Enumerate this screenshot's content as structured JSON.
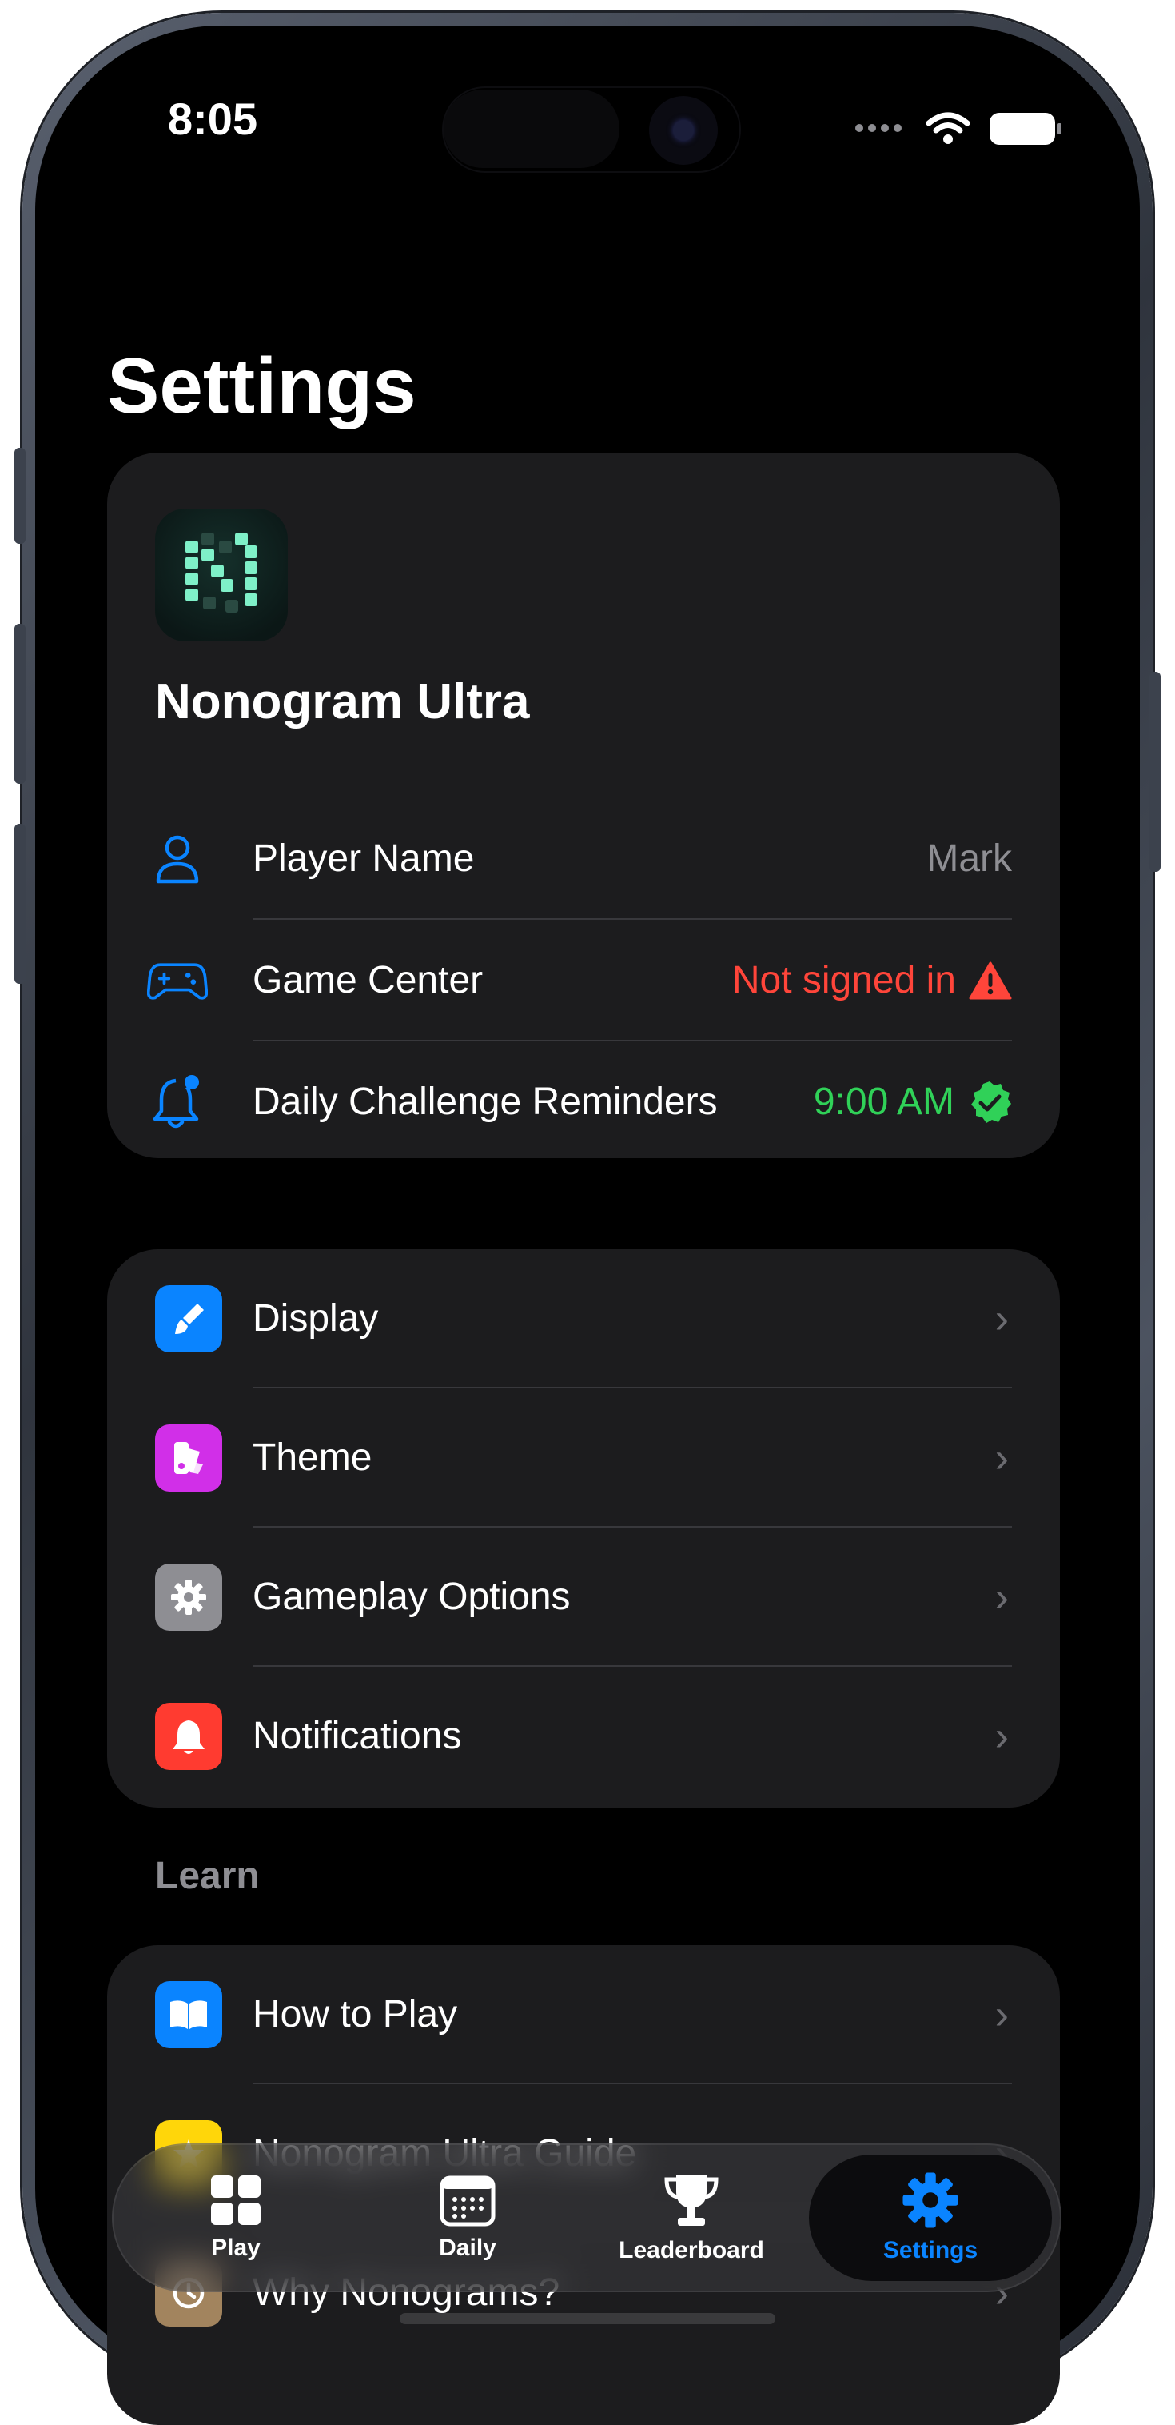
{
  "status_bar": {
    "time": "8:05"
  },
  "page": {
    "title": "Settings"
  },
  "app_card": {
    "app_name": "Nonogram Ultra",
    "rows": [
      {
        "label": "Player Name",
        "value": "Mark",
        "icon": "person-icon"
      },
      {
        "label": "Game Center",
        "value": "Not signed in",
        "icon": "gamecontroller-icon",
        "status_icon": "warning-triangle-icon"
      },
      {
        "label": "Daily Challenge Reminders",
        "value": "9:00 AM",
        "icon": "bell-badge-icon",
        "status_icon": "checkmark-seal-icon"
      }
    ]
  },
  "settings_menu": {
    "items": [
      {
        "label": "Display",
        "icon": "paintbrush-icon",
        "color": "#0a84ff"
      },
      {
        "label": "Theme",
        "icon": "swatchpalette-icon",
        "color": "#d12fe8"
      },
      {
        "label": "Gameplay Options",
        "icon": "gear-icon",
        "color": "#8e8e93"
      },
      {
        "label": "Notifications",
        "icon": "bell-icon",
        "color": "#ff3b30"
      }
    ]
  },
  "learn": {
    "section_label": "Learn",
    "items": [
      {
        "label": "How to Play",
        "icon": "book-icon",
        "color": "#0a84ff"
      },
      {
        "label": "Nonogram Ultra Guide",
        "icon": "star-icon",
        "color": "#ffd60a"
      },
      {
        "label": "Why Nonograms?",
        "icon": "clock-icon",
        "color": "#a2845e"
      }
    ]
  },
  "tab_bar": {
    "tabs": [
      {
        "label": "Play",
        "icon": "grid-icon"
      },
      {
        "label": "Daily",
        "icon": "calendar-icon"
      },
      {
        "label": "Leaderboard",
        "icon": "trophy-icon"
      },
      {
        "label": "Settings",
        "icon": "gear-icon",
        "active": true
      }
    ]
  },
  "colors": {
    "accent": "#0a84ff",
    "warning": "#ff453a",
    "success": "#30d158",
    "card": "#1c1c1e"
  }
}
